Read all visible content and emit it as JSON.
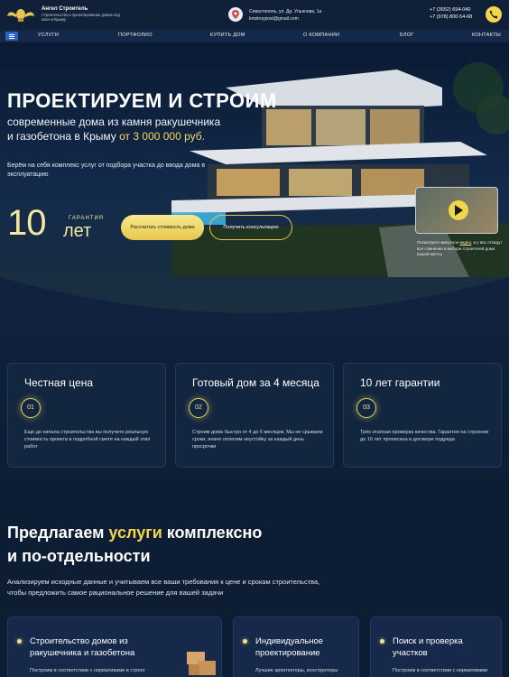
{
  "header": {
    "brand_name": "Ангел Строитель",
    "brand_desc": "Строительство и проектирование домов под ключ в Крыму",
    "address": [
      "Севастополь, ул. Др. Ульянова, 1а",
      "kmstroypost@gmail.com"
    ],
    "phones": [
      "+7 (3652) 694-040",
      "+7 (978) 800-54-68"
    ],
    "icons": {
      "logo": "wings-logo-icon",
      "location": "location-pin-icon",
      "phone": "phone-icon",
      "menu": "burger-menu-icon"
    },
    "accent_color": "#f1d64b"
  },
  "nav": {
    "items": [
      "УСЛУГИ",
      "ПОРТФОЛИО",
      "КУПИТЬ ДОМ",
      "О КОМПАНИИ",
      "БЛОГ",
      "КОНТАКТЫ"
    ]
  },
  "hero": {
    "title": "ПРОЕКТИРУЕМ И СТРОИМ",
    "subtitle_line1": "современные дома из камня ракушечника",
    "subtitle_line2": "и газобетона в Крыму",
    "subtitle_price": "от 3 000 000 руб.",
    "desc": "Берём на себя комплекс услуг от подбора участка до ввода дома в эксплуатацию",
    "guarantee_number": "10",
    "guarantee_label": "ГАРАНТИЯ",
    "guarantee_years": "лет",
    "btn_calc": "Рассчитать стоимость дома",
    "btn_consult": "Получить консультацию",
    "video_caption_pre": "Посмотрите минутное",
    "video_caption_link": "видео",
    "video_caption_post": ", и у вас отпадут все сомнения в выборе строителей дома вашей мечты"
  },
  "features": [
    {
      "title": "Честная цена",
      "num": "01",
      "text": "Еще до начала строительства вы получите реальную стоимость проекта в подробной смете на каждый этап работ"
    },
    {
      "title": "Готовый дом за 4 месяца",
      "num": "02",
      "text": "Строим дома быстро от 4 до 6 месяцев. Мы не срываем сроки, иначе оплатим неустойку за каждый день просрочки"
    },
    {
      "title": "10 лет гарантии",
      "num": "03",
      "text": "Трёх-этапная проверка качества. Гарантия на строение до 10 лет прописана в договоре подряда"
    }
  ],
  "services": {
    "title_pre": "Предлагаем ",
    "title_hl": "услуги",
    "title_post": " комплексно",
    "title_line2": "и по-отдельности",
    "lead": "Анализируем исходные данные и учитываем все ваши требования к цене и срокам строительства, чтобы предложить самое рациональное решение для вашей задачи",
    "cards": [
      {
        "title": "Строительство домов из ракушечника и газобетона",
        "text": "Построим в соответствии с нормативами и строго"
      },
      {
        "title": "Индивидуальное проектирование",
        "text": "Лучшие архитекторы, конструкторы"
      },
      {
        "title": "Поиск и проверка участков",
        "text": "Построим в соответствии с нормативами"
      }
    ]
  }
}
